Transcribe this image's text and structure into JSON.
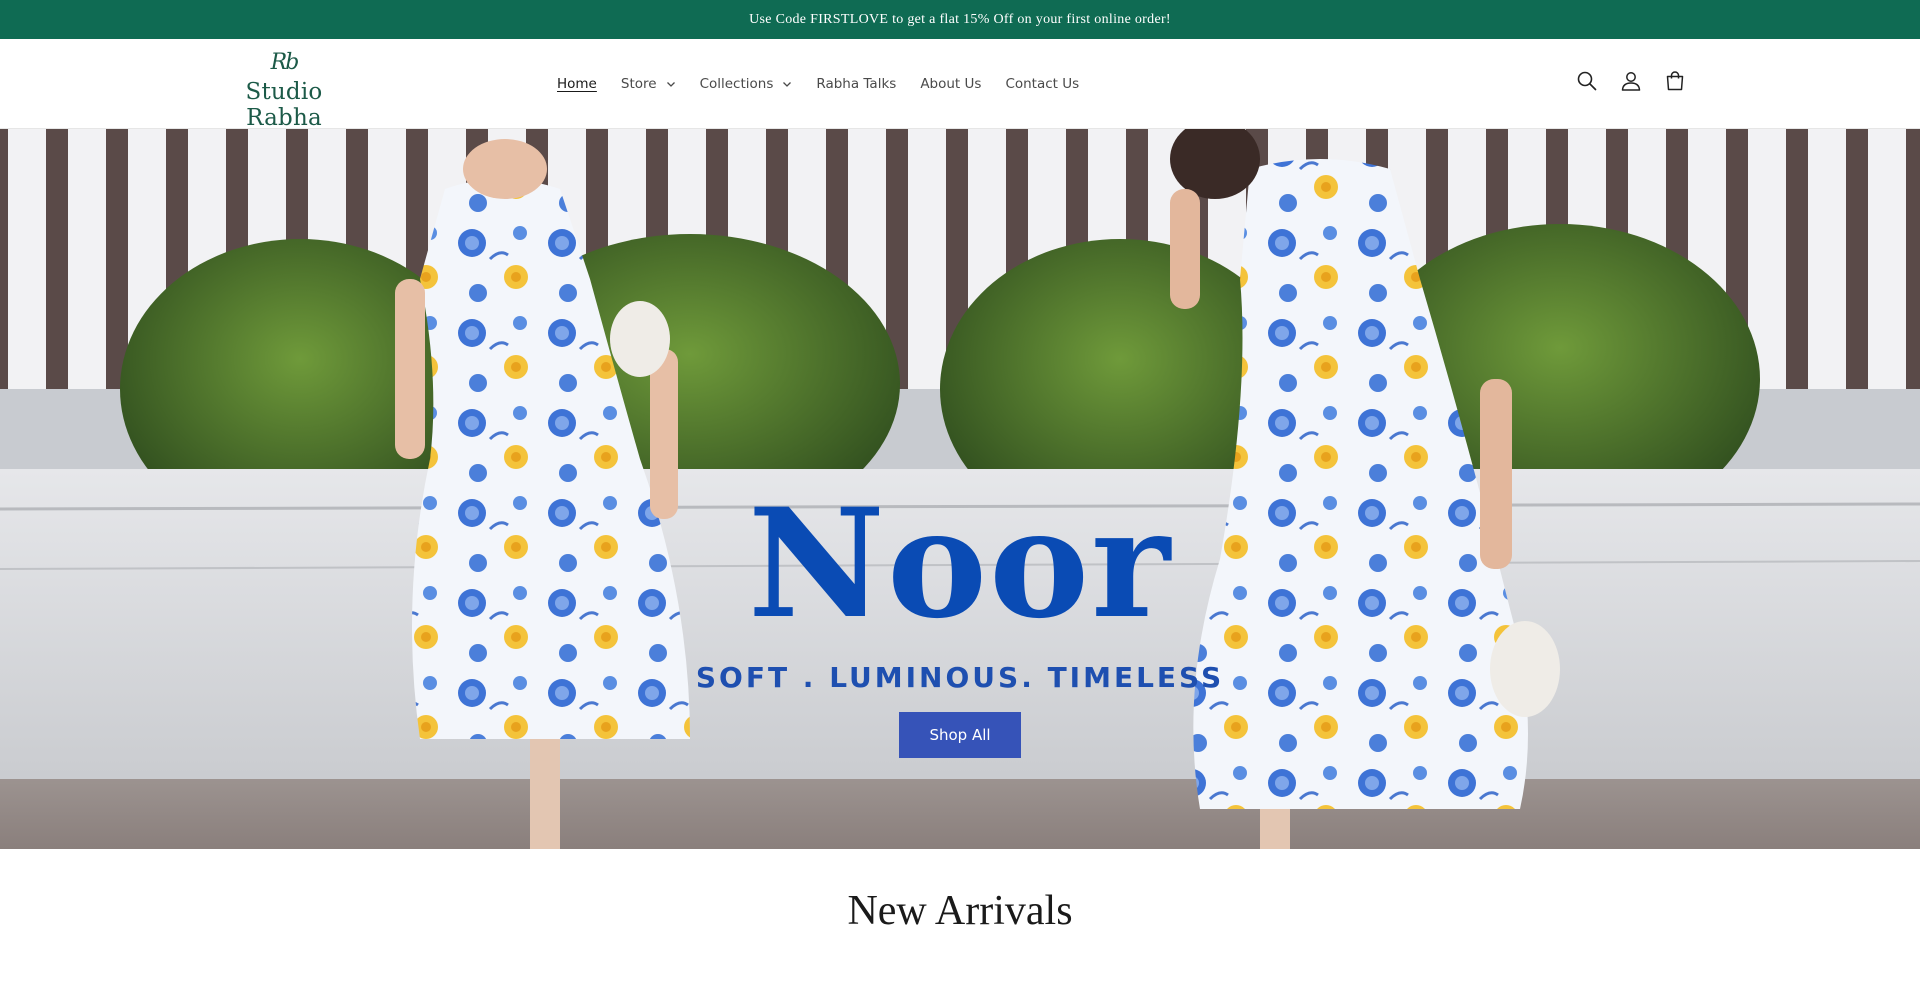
{
  "announcement": {
    "text": "Use Code FIRSTLOVE to get a flat 15% Off on your first online order!"
  },
  "header": {
    "logo": {
      "mark": "Rb",
      "name": "Studio Rabha"
    },
    "nav": [
      {
        "label": "Home",
        "active": true
      },
      {
        "label": "Store",
        "has_dropdown": true
      },
      {
        "label": "Collections",
        "has_dropdown": true
      },
      {
        "label": "Rabha Talks"
      },
      {
        "label": "About Us"
      },
      {
        "label": "Contact Us"
      }
    ],
    "icons": [
      "search-icon",
      "account-icon",
      "cart-icon"
    ]
  },
  "hero": {
    "title": "Noor",
    "subtitle": "SOFT . LUMINOUS. TIMELESS",
    "button_label": "Shop All"
  },
  "sections": {
    "new_arrivals_title": "New Arrivals"
  },
  "colors": {
    "announcement_bg": "#0f6b53",
    "brand_green": "#1c5a48",
    "hero_title": "#0a4bb4",
    "button_bg": "#3653b8"
  }
}
